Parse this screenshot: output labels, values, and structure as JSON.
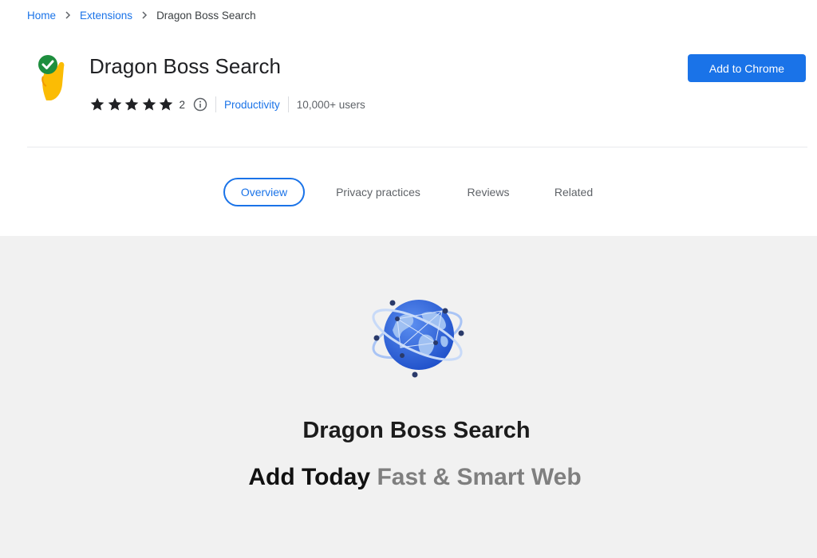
{
  "breadcrumb": {
    "items": [
      "Home",
      "Extensions",
      "Dragon Boss Search"
    ],
    "separator": ">"
  },
  "extension": {
    "title": "Dragon Boss Search",
    "rating": {
      "stars": 5,
      "count": "2"
    },
    "category": "Productivity",
    "users": "10,000+ users",
    "icon": "hand-checkmark-icon"
  },
  "actions": {
    "add_label": "Add to Chrome"
  },
  "tabs": [
    {
      "label": "Overview",
      "active": true
    },
    {
      "label": "Privacy practices",
      "active": false
    },
    {
      "label": "Reviews",
      "active": false
    },
    {
      "label": "Related",
      "active": false
    }
  ],
  "hero": {
    "title": "Dragon Boss Search",
    "tagline_part1": "Add Today",
    "tagline_part2": "Fast & Smart Web",
    "icon": "globe-icon"
  },
  "colors": {
    "accent": "#1a73e8",
    "hero_bg": "#f1f1f1",
    "icon_yellow": "#fbbc04",
    "check_green": "#1e8e3e"
  }
}
